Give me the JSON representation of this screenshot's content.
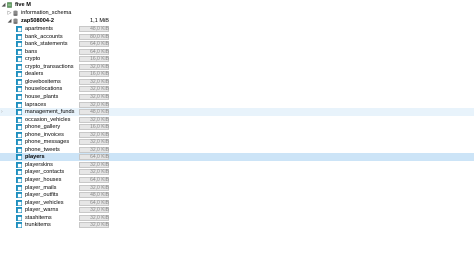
{
  "connection": {
    "label": "five M"
  },
  "databases": [
    {
      "label": "information_schema"
    },
    {
      "label": "zap508004-2",
      "size": "1,1 MiB"
    }
  ],
  "tables": [
    {
      "label": "apartments",
      "size": "48,0 KiB"
    },
    {
      "label": "bank_accounts",
      "size": "80,0 KiB"
    },
    {
      "label": "bank_statements",
      "size": "64,0 KiB"
    },
    {
      "label": "bans",
      "size": "64,0 KiB"
    },
    {
      "label": "crypto",
      "size": "16,0 KiB"
    },
    {
      "label": "crypto_transactions",
      "size": "32,0 KiB"
    },
    {
      "label": "dealers",
      "size": "16,0 KiB"
    },
    {
      "label": "gloveboxitems",
      "size": "32,0 KiB"
    },
    {
      "label": "houselocations",
      "size": "32,0 KiB"
    },
    {
      "label": "house_plants",
      "size": "32,0 KiB"
    },
    {
      "label": "lapraces",
      "size": "32,0 KiB"
    },
    {
      "label": "management_funds",
      "size": "48,0 KiB"
    },
    {
      "label": "occasion_vehicles",
      "size": "32,0 KiB"
    },
    {
      "label": "phone_gallery",
      "size": "16,0 KiB"
    },
    {
      "label": "phone_invoices",
      "size": "32,0 KiB"
    },
    {
      "label": "phone_messages",
      "size": "32,0 KiB"
    },
    {
      "label": "phone_tweets",
      "size": "32,0 KiB"
    },
    {
      "label": "players",
      "size": "64,0 KiB"
    },
    {
      "label": "playerskins",
      "size": "32,0 KiB"
    },
    {
      "label": "player_contacts",
      "size": "32,0 KiB"
    },
    {
      "label": "player_houses",
      "size": "64,0 KiB"
    },
    {
      "label": "player_mails",
      "size": "32,0 KiB"
    },
    {
      "label": "player_outfits",
      "size": "48,0 KiB"
    },
    {
      "label": "player_vehicles",
      "size": "64,0 KiB"
    },
    {
      "label": "player_warns",
      "size": "32,0 KiB"
    },
    {
      "label": "stashitems",
      "size": "32,0 KiB"
    },
    {
      "label": "trunkitems",
      "size": "32,0 KiB"
    }
  ],
  "highlighted": {
    "hover": "management_funds",
    "selected": "players"
  },
  "colors": {
    "table_icon": "#1f8fbf",
    "db_icon": "#6b6b6b",
    "selected_bg": "#cce4f7",
    "hover_bg": "#e8f3fb"
  }
}
